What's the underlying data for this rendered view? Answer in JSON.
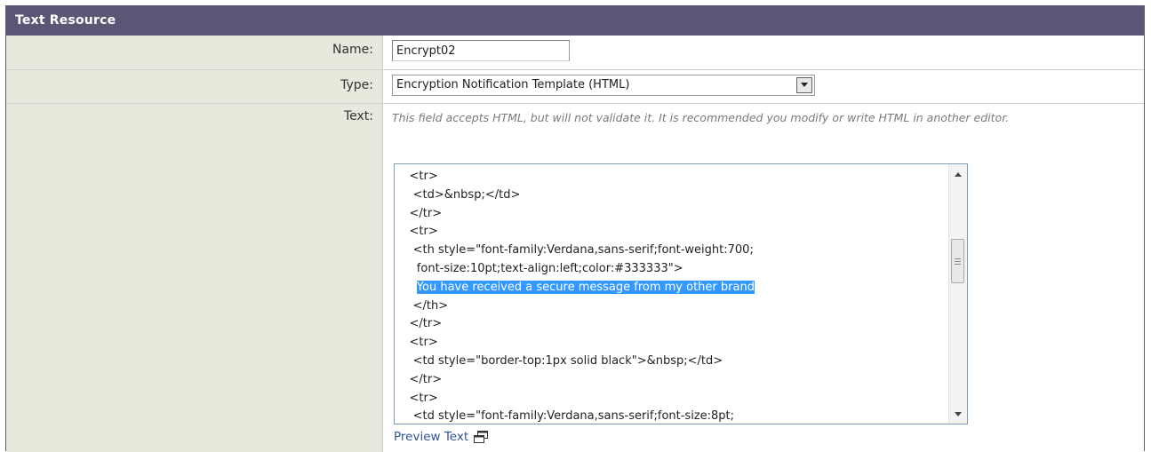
{
  "panel": {
    "title": "Text Resource"
  },
  "form": {
    "name": {
      "label": "Name:",
      "value": "Encrypt02"
    },
    "type": {
      "label": "Type:",
      "selected": "Encryption Notification Template (HTML)"
    },
    "text": {
      "label": "Text:",
      "help": "This field accepts HTML, but will not validate it. It is recommended you modify or write HTML in another editor.",
      "lines": [
        "    <tr>",
        "     <td>&nbsp;</td>",
        "    </tr>",
        "    <tr>",
        "     <th style=\"font-family:Verdana,sans-serif;font-weight:700;",
        "      font-size:10pt;text-align:left;color:#333333\">",
        "      You have received a secure message from my other brand",
        "     </th>",
        "    </tr>",
        "    <tr>",
        "     <td style=\"border-top:1px solid black\">&nbsp;</td>",
        "    </tr>",
        "    <tr>",
        "     <td style=\"font-family:Verdana,sans-serif;font-size:8pt;"
      ],
      "selected_line_index": 6
    },
    "preview": {
      "label": "Preview Text",
      "icon": "popup-window-icon"
    }
  },
  "icons": {
    "dropdown": "chevron-down-icon",
    "scroll_up": "arrow-up-icon",
    "scroll_down": "arrow-down-icon",
    "thumb_grip": "grip-icon"
  },
  "colors": {
    "header": "#5a5776",
    "label_bg": "#e8e8dc",
    "selection": "#3399ff",
    "link": "#2f5597"
  }
}
